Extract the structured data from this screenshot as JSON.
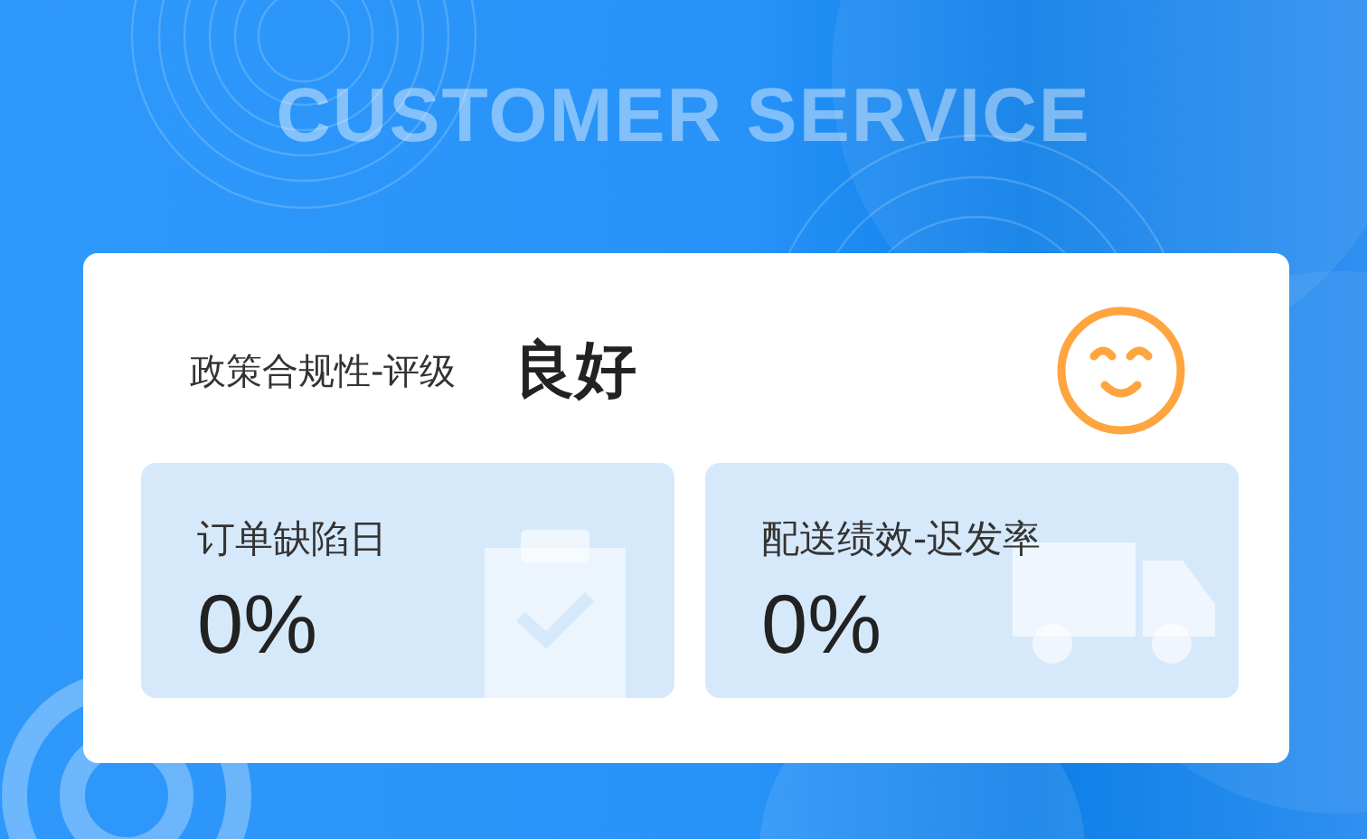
{
  "banner": {
    "title": "CUSTOMER SERVICE"
  },
  "rating": {
    "label": "政策合规性-评级",
    "value": "良好"
  },
  "metrics": [
    {
      "kind": "order",
      "label": "订单缺陷日",
      "value": "0%"
    },
    {
      "kind": "delivery",
      "label": "配送绩效-迟发率",
      "value": "0%"
    }
  ]
}
